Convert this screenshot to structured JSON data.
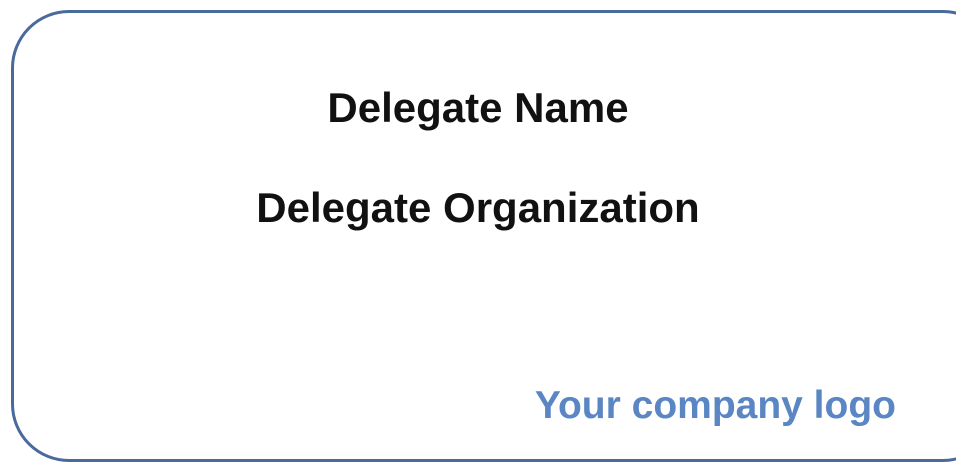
{
  "badge": {
    "delegate_name": "Delegate Name",
    "delegate_organization": "Delegate Organization",
    "logo_placeholder": "Your company logo"
  },
  "colors": {
    "border": "#4a6a9c",
    "text": "#111111",
    "logo_text": "#5a86c4",
    "background": "#ffffff"
  }
}
